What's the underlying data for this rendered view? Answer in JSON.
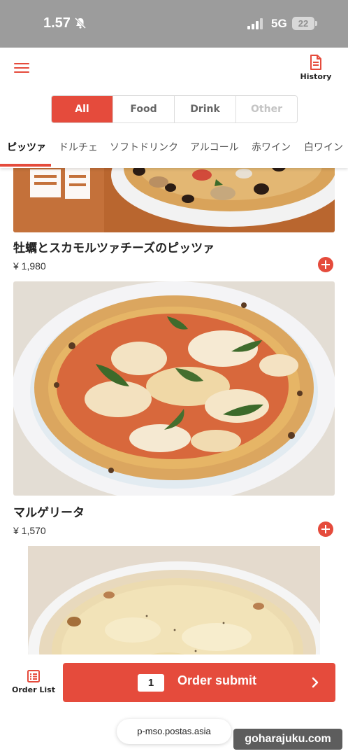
{
  "status_bar": {
    "time": "1.57",
    "network": "5G",
    "battery": "22",
    "icons": [
      "bell-off-icon",
      "signal-icon",
      "battery-icon"
    ]
  },
  "header": {
    "menu_icon": "hamburger-icon",
    "history_label": "History",
    "history_icon": "document-icon",
    "segments": [
      {
        "label": "All",
        "state": "active"
      },
      {
        "label": "Food",
        "state": "normal"
      },
      {
        "label": "Drink",
        "state": "normal"
      },
      {
        "label": "Other",
        "state": "disabled"
      }
    ],
    "category_tabs": [
      "ピッツァ",
      "ドルチェ",
      "ソフトドリンク",
      "アルコール",
      "赤ワイン",
      "白ワイン"
    ],
    "active_category": "ピッツァ"
  },
  "menu_items": [
    {
      "name": "牡蠣とスカモルツァチーズのピッツァ",
      "price": "¥ 1,980"
    },
    {
      "name": "マルゲリータ",
      "price": "¥ 1,570"
    }
  ],
  "bottom_bar": {
    "order_list_label": "Order List",
    "order_count": "1",
    "submit_label": "Order submit"
  },
  "browser": {
    "url": "p-mso.postas.asia",
    "watermark": "goharajuku.com"
  },
  "colors": {
    "accent": "#e54b3c",
    "status_bar": "#9c9c9c"
  }
}
